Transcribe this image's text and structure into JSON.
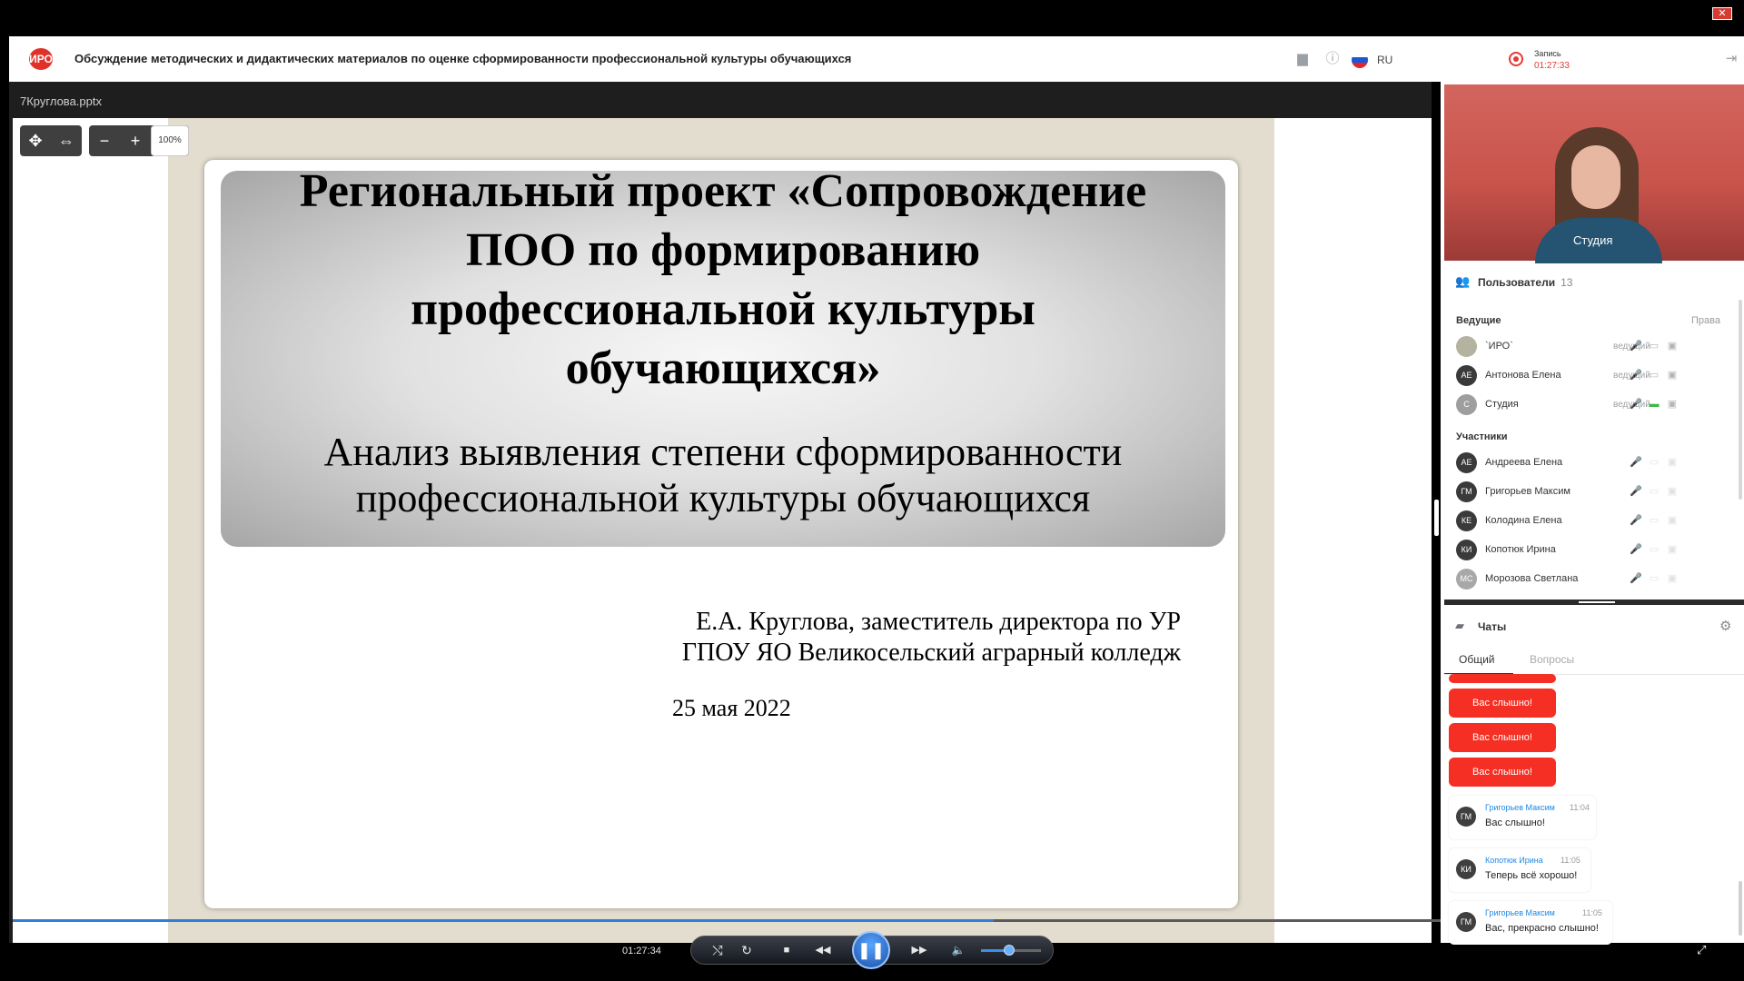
{
  "os": {
    "close_glyph": "✕"
  },
  "header": {
    "logo_text": "ИРО",
    "title": "Обсуждение методических и дидактических материалов по оценке сформированности профессиональной культуры обучающихся",
    "record_label": "Запись",
    "record_time": "01:27:33",
    "icons": [
      "folder-icon",
      "info-icon",
      "exit-icon"
    ],
    "language": "RU",
    "flag_colors": [
      "#ffffff",
      "#1c57d6",
      "#e0262b"
    ]
  },
  "presentation": {
    "file_name": "7Круглова.pptx",
    "zoom": "100%",
    "tools": {
      "move_glyph": "✥",
      "fit_glyph": "⇔",
      "zoom_out_glyph": "−",
      "zoom_in_glyph": "+"
    },
    "slide": {
      "title_lines": [
        "Региональный проект «Сопровождение",
        "ПОО по формированию",
        "профессиональной культуры",
        "обучающихся»"
      ],
      "subtitle_lines": [
        "Анализ выявления степени сформированности",
        "профессиональной культуры обучающихся"
      ],
      "author_lines": [
        "Е.А. Круглова, заместитель директора по УР",
        "ГПОУ ЯО Великосельский аграрный колледж"
      ],
      "date": "25 мая 2022"
    }
  },
  "player": {
    "current_time": "01:27:34",
    "progress": 0.57,
    "volume": 0.47,
    "glyphs": {
      "shuffle": "⤭",
      "repeat": "↻",
      "stop": "■",
      "rewind": "◀◀",
      "pause": "❚❚",
      "forward": "▶▶",
      "volume": "🔈",
      "fullscreen": "⤢"
    }
  },
  "video": {
    "name": "Студия"
  },
  "users": {
    "header": "Пользователи",
    "count": "13",
    "hosts_label": "Ведущие",
    "rights_label": "Права",
    "participants_label": "Участники",
    "hosts": [
      {
        "initials": "",
        "name": "`ИРО`",
        "role": "ведущий",
        "avatar_color": "#b3b3a0",
        "mic": "mic-off-icon",
        "cam": "cam-off-icon",
        "screen": "screen-icon",
        "mic_glyph": "🎤",
        "cam_glyph": "▭",
        "screen_glyph": "▣"
      },
      {
        "initials": "АЕ",
        "name": "Антонова Елена",
        "role": "ведущий",
        "avatar_color": "#3a3a3a",
        "mic": "mic-off-icon",
        "cam": "cam-off-icon",
        "screen": "screen-icon",
        "mic_glyph": "🎤",
        "cam_glyph": "▭",
        "screen_glyph": "▣"
      },
      {
        "initials": "С",
        "name": "Студия",
        "role": "ведущий",
        "avatar_color": "#9e9e9e",
        "mic": "mic-on-icon",
        "cam": "cam-on-icon",
        "screen": "screen-icon",
        "mic_glyph": "🎤",
        "cam_glyph": "▬",
        "screen_glyph": "▣"
      }
    ],
    "participants": [
      {
        "initials": "АЕ",
        "name": "Андреева Елена",
        "avatar_color": "#3a3a3a"
      },
      {
        "initials": "ГМ",
        "name": "Григорьев Максим",
        "avatar_color": "#3a3a3a"
      },
      {
        "initials": "КЕ",
        "name": "Колодина Елена",
        "avatar_color": "#3a3a3a"
      },
      {
        "initials": "КИ",
        "name": "Копотюк Ирина",
        "avatar_color": "#3a3a3a"
      },
      {
        "initials": "МС",
        "name": "Морозова Светлана",
        "avatar_color": "#a8a8a8"
      }
    ]
  },
  "chats": {
    "header": "Чаты",
    "tabs": [
      "Общий",
      "Вопросы"
    ],
    "red_messages": [
      "Вас слышно!",
      "Вас слышно!",
      "Вас слышно!"
    ],
    "messages": [
      {
        "initials": "ГМ",
        "author": "Григорьев Максим",
        "time": "11:04",
        "text": "Вас слышно!"
      },
      {
        "initials": "КИ",
        "author": "Копотюк Ирина",
        "time": "11:05",
        "text": "Теперь всё хорошо!"
      },
      {
        "initials": "ГМ",
        "author": "Григорьев Максим",
        "time": "11:05",
        "text": "Вас, прекрасно слышно!"
      }
    ]
  }
}
